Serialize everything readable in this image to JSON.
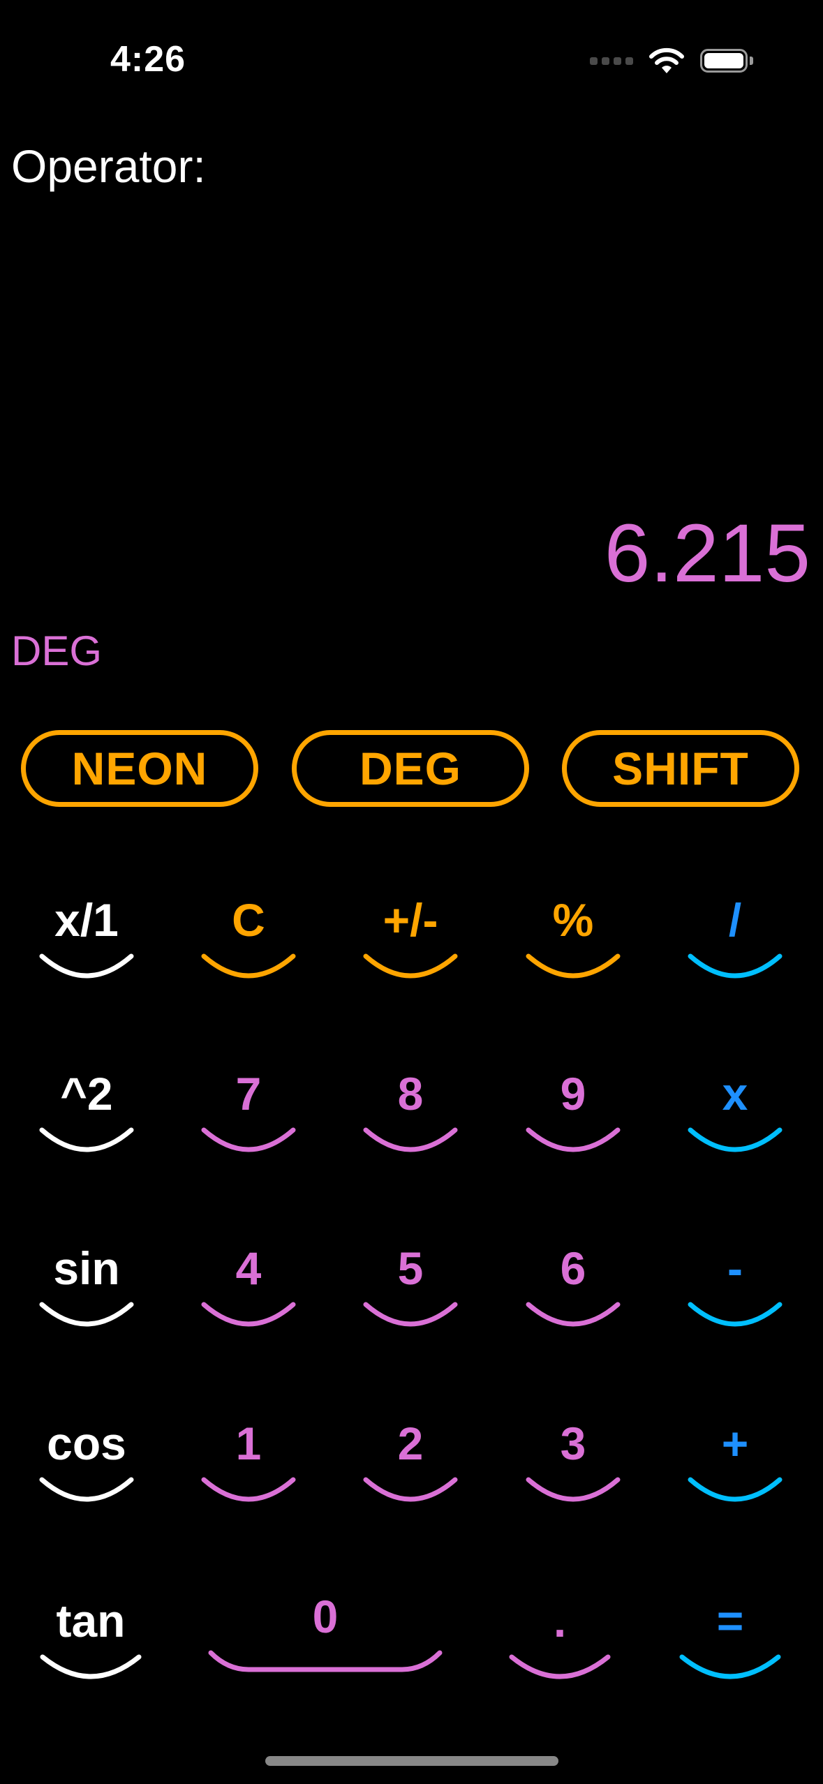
{
  "status_bar": {
    "time": "4:26"
  },
  "icons": {
    "wifi": "wifi-icon",
    "battery": "battery-icon",
    "signal": "cellular-signal-icon"
  },
  "display": {
    "operator_label": "Operator:",
    "value": "6.215",
    "mode": "DEG"
  },
  "mode_buttons": {
    "neon": "NEON",
    "deg": "DEG",
    "shift": "SHIFT"
  },
  "keys": {
    "row1": [
      "x/1",
      "C",
      "+/-",
      "%",
      "/"
    ],
    "row2": [
      "^2",
      "7",
      "8",
      "9",
      "x"
    ],
    "row3": [
      "sin",
      "4",
      "5",
      "6",
      "-"
    ],
    "row4": [
      "cos",
      "1",
      "2",
      "3",
      "+"
    ],
    "row5": [
      "tan",
      "0",
      ".",
      "="
    ]
  },
  "colors": {
    "background": "#000000",
    "function_key": "#ffffff",
    "control_key": "#ffa500",
    "digit_key": "#da70d6",
    "operator_key": "#1e90ff",
    "operator_arc": "#00bfff",
    "display_text": "#da70d6",
    "pill_border": "#ffa500"
  }
}
